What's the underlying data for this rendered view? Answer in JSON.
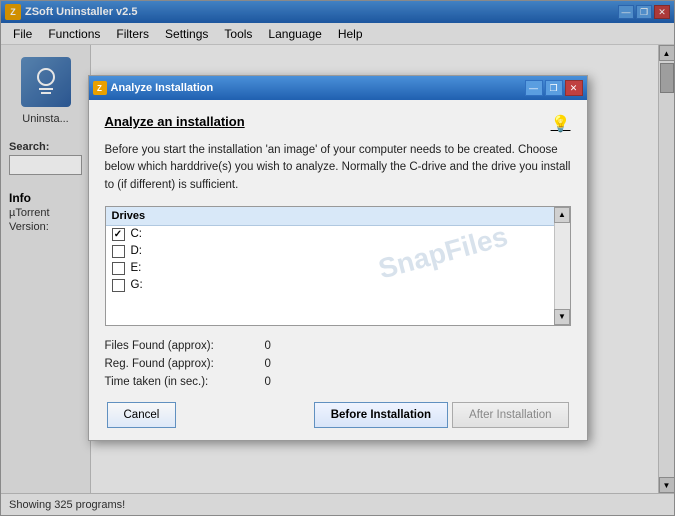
{
  "window": {
    "title": "ZSoft Uninstaller v2.5",
    "icon": "Z"
  },
  "menu": {
    "items": [
      "File",
      "Functions",
      "Filters",
      "Settings",
      "Tools",
      "Language",
      "Help"
    ]
  },
  "left_panel": {
    "uninstall_label": "Uninsta...",
    "search_label": "Search:",
    "search_placeholder": "",
    "info_title": "Info",
    "info_name": "µTorrent",
    "info_version_label": "Version:"
  },
  "status_bar": {
    "text": "Showing 325 programs!"
  },
  "dialog": {
    "title": "Analyze Installation",
    "icon": "Z",
    "heading": "Analyze an installation",
    "description": "Before you start the installation 'an image' of your computer needs to be created. Choose below which harddrive(s) you wish to analyze. Normally the C-drive and the drive you install to (if different) is sufficient.",
    "drives_header": "Drives",
    "drives": [
      {
        "letter": "C:",
        "checked": true
      },
      {
        "letter": "D:",
        "checked": false
      },
      {
        "letter": "E:",
        "checked": false
      },
      {
        "letter": "G:",
        "checked": false
      }
    ],
    "watermark": "SnapFiles",
    "stats": [
      {
        "label": "Files Found (approx):",
        "value": "0"
      },
      {
        "label": "Reg. Found (approx):",
        "value": "0"
      },
      {
        "label": "Time taken (in sec.):",
        "value": "0"
      }
    ],
    "buttons": {
      "cancel": "Cancel",
      "before_installation": "Before Installation",
      "after_installation": "After Installation"
    },
    "title_controls": {
      "minimize": "—",
      "restore": "❐",
      "close": "✕"
    }
  },
  "title_controls": {
    "minimize": "—",
    "restore": "❐",
    "close": "✕"
  }
}
